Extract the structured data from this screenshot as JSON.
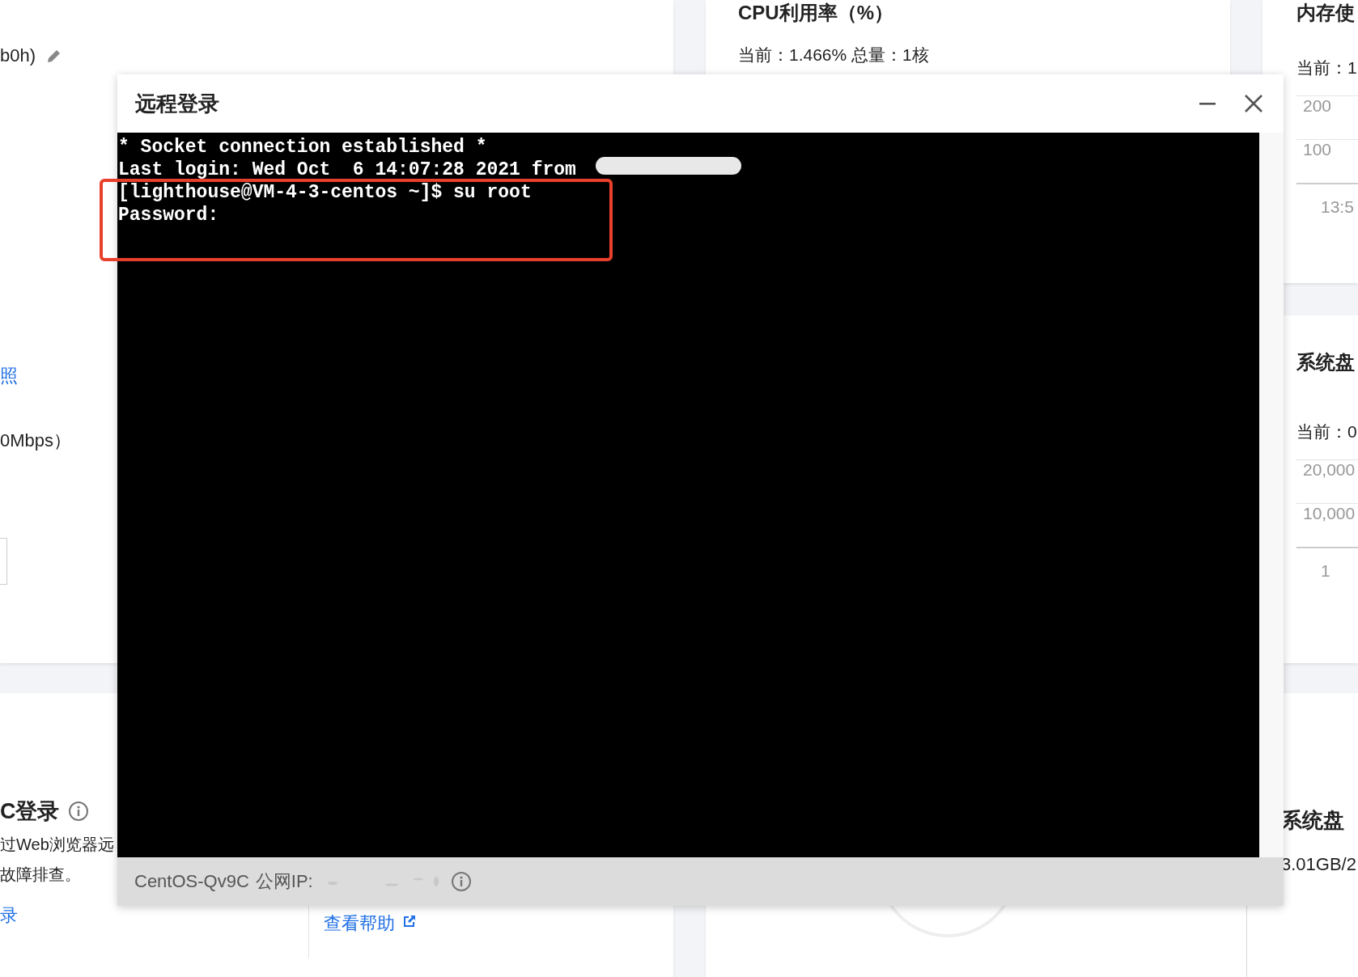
{
  "background": {
    "instance_panel": {
      "name_fragment": "b0h)",
      "link": "照",
      "bandwidth": "0Mbps）"
    },
    "vnc_section": {
      "title": "C登录",
      "description_lines": [
        "过Web浏览器远",
        "故障排查。"
      ],
      "link": "录",
      "help_link": "查看帮助"
    },
    "cpu_card": {
      "title": "CPU利用率（%）",
      "reading": "当前：1.466% 总量：1核"
    },
    "memory_card": {
      "title": "内存使",
      "reading": "当前：1",
      "y_labels": [
        "200",
        "100"
      ],
      "x_label": "13:5"
    },
    "disk_card": {
      "title": "系统盘",
      "reading": "当前：0",
      "y_labels": [
        "20,000",
        "10,000"
      ],
      "x_label": "1"
    },
    "disk_usage": {
      "title": "系统盘",
      "value": "3.01GB/2"
    }
  },
  "dialog": {
    "title": "远程登录",
    "terminal_lines": [
      "* Socket connection established *",
      "Last login: Wed Oct  6 14:07:28 2021 from ",
      "[lighthouse@VM-4-3-centos ~]$ su root",
      "Password:"
    ],
    "footer": {
      "instance": "CentOS-Qv9C",
      "ip_label": "公网IP:"
    }
  }
}
